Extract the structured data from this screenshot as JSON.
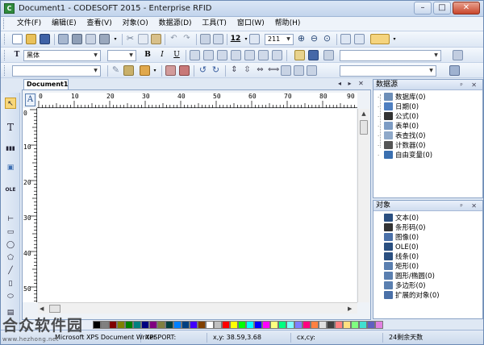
{
  "window": {
    "title": "Document1 - CODESOFT 2015 - Enterprise RFID",
    "app_icon": "C",
    "minimize": "–",
    "maximize": "□",
    "close": "✕"
  },
  "menu": [
    "文件(F)",
    "编辑(E)",
    "查看(V)",
    "对象(O)",
    "数据源(D)",
    "工具(T)",
    "窗口(W)",
    "帮助(H)"
  ],
  "toolbar1": {
    "font_size_value": "12",
    "zoom_value": "211"
  },
  "toolbar2": {
    "font_name": "黑体",
    "font_size": "",
    "bold": "B",
    "italic": "I",
    "underline": "U"
  },
  "document": {
    "tab_label": "Document1",
    "tab_controls": "◂ ▸ ✕",
    "ruler_corner": "A",
    "h_ruler": [
      "0",
      "10",
      "20",
      "30",
      "40",
      "50",
      "60",
      "70",
      "80",
      "90"
    ],
    "v_ruler": [
      "0",
      "10",
      "20",
      "30",
      "40",
      "50"
    ]
  },
  "left_tools": [
    "↖",
    "T",
    "▮▮▮",
    "▣",
    "OLE",
    "⊢",
    "▭",
    "◯",
    "⬠",
    "╱",
    "▯",
    "⬭",
    "▤"
  ],
  "palette": [
    "#000000",
    "#808080",
    "#800000",
    "#808000",
    "#008000",
    "#008080",
    "#000080",
    "#800080",
    "#808040",
    "#004040",
    "#0080ff",
    "#004080",
    "#4000ff",
    "#804000",
    "#ffffff",
    "#c0c0c0",
    "#ff0000",
    "#ffff00",
    "#00ff00",
    "#00ffff",
    "#0000ff",
    "#ff00ff",
    "#ffff80",
    "#00ff80",
    "#80ffff",
    "#8080ff",
    "#ff0080",
    "#ff8040",
    "#e0e0e0",
    "#404040",
    "#ff8080",
    "#ffe080",
    "#80ff80",
    "#40e0d0",
    "#6060c0",
    "#e080e0"
  ],
  "datasource_panel": {
    "title": "数据源",
    "pins": "ᵖ ✕",
    "items": [
      {
        "label": "数据库(0)",
        "icon": "database-icon",
        "color": "#6e8fb8"
      },
      {
        "label": "日期(0)",
        "icon": "calendar-icon",
        "color": "#4f7fc0"
      },
      {
        "label": "公式(0)",
        "icon": "formula-icon",
        "color": "#333333"
      },
      {
        "label": "表单(0)",
        "icon": "form-icon",
        "color": "#7d9cc4"
      },
      {
        "label": "表查找(0)",
        "icon": "table-lookup-icon",
        "color": "#8fa9c9"
      },
      {
        "label": "计数器(0)",
        "icon": "counter-icon",
        "color": "#555555"
      },
      {
        "label": "自由变量(0)",
        "icon": "free-variable-icon",
        "color": "#3a6fb0"
      }
    ]
  },
  "objects_panel": {
    "title": "对象",
    "pins": "ᵖ ✕",
    "items": [
      {
        "label": "文本(0)",
        "icon": "text-icon",
        "color": "#2a4f80"
      },
      {
        "label": "条形码(0)",
        "icon": "barcode-icon",
        "color": "#333333"
      },
      {
        "label": "图像(0)",
        "icon": "image-icon",
        "color": "#4a70a8"
      },
      {
        "label": "OLE(0)",
        "icon": "ole-icon",
        "color": "#2a4f80"
      },
      {
        "label": "线条(0)",
        "icon": "line-icon",
        "color": "#2a4f80"
      },
      {
        "label": "矩形(0)",
        "icon": "rectangle-icon",
        "color": "#5a7fb0"
      },
      {
        "label": "圆形/椭圆(0)",
        "icon": "ellipse-icon",
        "color": "#5a7fb0"
      },
      {
        "label": "多边形(0)",
        "icon": "polygon-icon",
        "color": "#5a7fb0"
      },
      {
        "label": "扩展的对象(0)",
        "icon": "extended-object-icon",
        "color": "#4a70a8"
      }
    ]
  },
  "status": {
    "printer": "Microsoft XPS Document Writer",
    "port": "XPSPORT:",
    "xy": "x,y: 38.59,3.68",
    "cxcy": "cx,cy:",
    "days": "24剩余天数"
  },
  "watermark": {
    "logo": "合众软件园",
    "url": "www.hezhong.net"
  }
}
